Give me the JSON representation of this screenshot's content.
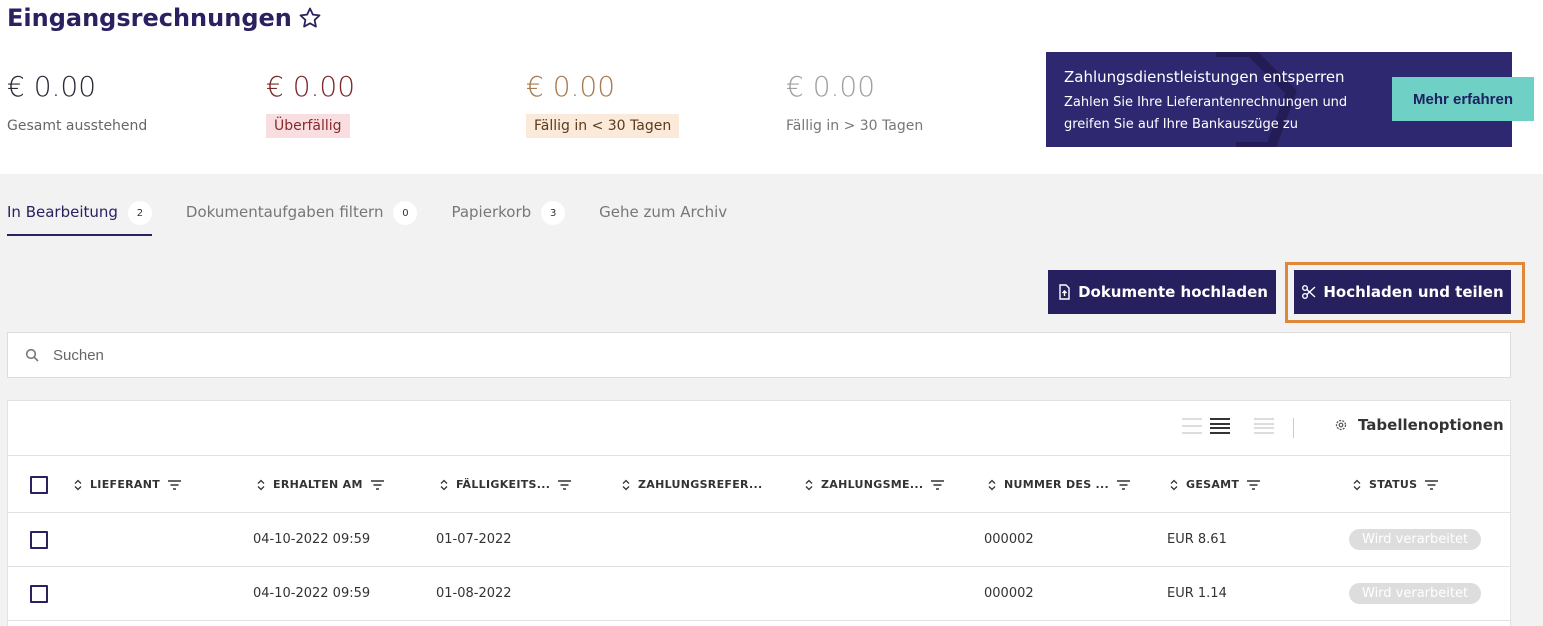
{
  "page": {
    "title": "Eingangsrechnungen"
  },
  "stats": [
    {
      "amount": "€ 0.00",
      "label": "Gesamt ausstehend"
    },
    {
      "amount": "€ 0.00",
      "label": "Überfällig"
    },
    {
      "amount": "€ 0.00",
      "label": "Fällig in < 30 Tagen"
    },
    {
      "amount": "€ 0.00",
      "label": "Fällig in > 30 Tagen"
    }
  ],
  "promo": {
    "title": "Zahlungsdienstleistungen entsperren",
    "text": "Zahlen Sie Ihre Lieferantenrechnungen und greifen Sie auf Ihre Bankauszüge zu",
    "button": "Mehr erfahren"
  },
  "tabs": [
    {
      "label": "In Bearbeitung",
      "count": "2"
    },
    {
      "label": "Dokumentaufgaben filtern",
      "count": "0"
    },
    {
      "label": "Papierkorb",
      "count": "3"
    },
    {
      "label": "Gehe zum Archiv"
    }
  ],
  "actions": {
    "upload": "Dokumente hochladen",
    "split": "Hochladen und teilen"
  },
  "search": {
    "placeholder": "Suchen"
  },
  "table": {
    "options_label": "Tabellenoptionen",
    "columns": [
      "LIEFERANT",
      "ERHALTEN AM",
      "FÄLLIGKEITS...",
      "ZAHLUNGSREFER...",
      "ZAHLUNGSME...",
      "NUMMER DES ...",
      "GESAMT",
      "STATUS"
    ],
    "rows": [
      {
        "lieferant": "",
        "erhalten": "04-10-2022 09:59",
        "faellig": "01-07-2022",
        "referenz": "",
        "methode": "",
        "nummer": "000002",
        "gesamt": "EUR 8.61",
        "status": "Wird verarbeitet"
      },
      {
        "lieferant": "",
        "erhalten": "04-10-2022 09:59",
        "faellig": "01-08-2022",
        "referenz": "",
        "methode": "",
        "nummer": "000002",
        "gesamt": "EUR 1.14",
        "status": "Wird verarbeitet"
      }
    ]
  },
  "icons": [
    "star-icon",
    "upload-file-icon",
    "scissors-icon",
    "search-icon",
    "gear-icon",
    "sort-icon",
    "filter-icon"
  ]
}
